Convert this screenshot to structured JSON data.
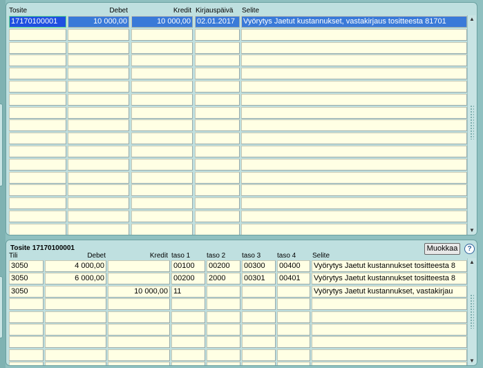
{
  "top_grid": {
    "headers": {
      "tosite": "Tosite",
      "debet": "Debet",
      "kredit": "Kredit",
      "kirjauspaiva": "Kirjauspäivä",
      "selite": "Selite"
    },
    "rows": [
      {
        "tosite": "17170100001",
        "debet": "10 000,00",
        "kredit": "10 000,00",
        "kirjauspaiva": "02.01.2017",
        "selite": "Vyörytys Jaetut kustannukset, vastakirjaus tositteesta 81701"
      }
    ],
    "total_rows": 17
  },
  "bottom": {
    "title": "Tosite",
    "tosite_no": "17170100001",
    "edit_button": "Muokkaa",
    "help_icon": "?",
    "headers": {
      "tili": "Tili",
      "debet": "Debet",
      "kredit": "Kredit",
      "taso1": "taso 1",
      "taso2": "taso 2",
      "taso3": "taso 3",
      "taso4": "taso 4",
      "selite": "Selite"
    },
    "rows": [
      {
        "tili": "3050",
        "debet": "4 000,00",
        "kredit": "",
        "taso1": "00100",
        "taso2": "00200",
        "taso3": "00300",
        "taso4": "00400",
        "selite": "Vyörytys Jaetut kustannukset tositteesta 8"
      },
      {
        "tili": "3050",
        "debet": "6 000,00",
        "kredit": "",
        "taso1": "00200",
        "taso2": "2000",
        "taso3": "00301",
        "taso4": "00401",
        "selite": "Vyörytys Jaetut kustannukset tositteesta 8"
      },
      {
        "tili": "3050",
        "debet": "",
        "kredit": "10 000,00",
        "taso1": "11",
        "taso2": "",
        "taso3": "",
        "taso4": "",
        "selite": "Vyörytys Jaetut kustannukset, vastakirjau"
      }
    ],
    "total_rows": 9
  }
}
